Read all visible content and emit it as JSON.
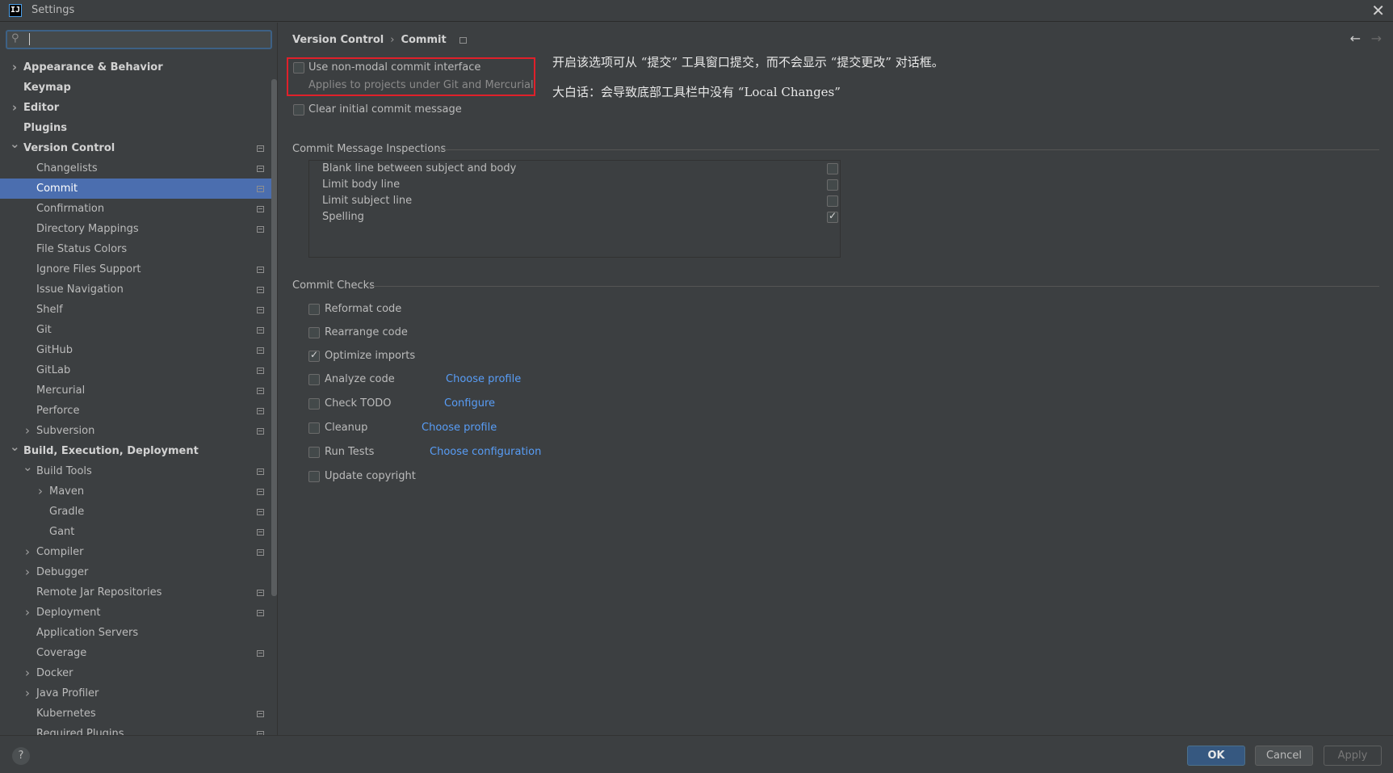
{
  "window": {
    "title": "Settings",
    "app_icon_text": "IJ"
  },
  "search": {
    "value": ""
  },
  "sidebar": {
    "items": [
      {
        "label": "Appearance & Behavior",
        "level": 0,
        "arrow": "right",
        "bold": true,
        "proj": false,
        "selected": false
      },
      {
        "label": "Keymap",
        "level": 0,
        "arrow": "",
        "bold": true,
        "proj": false,
        "selected": false
      },
      {
        "label": "Editor",
        "level": 0,
        "arrow": "right",
        "bold": true,
        "proj": false,
        "selected": false
      },
      {
        "label": "Plugins",
        "level": 0,
        "arrow": "",
        "bold": true,
        "proj": false,
        "selected": false
      },
      {
        "label": "Version Control",
        "level": 0,
        "arrow": "down",
        "bold": true,
        "proj": true,
        "selected": false
      },
      {
        "label": "Changelists",
        "level": 1,
        "arrow": "",
        "bold": false,
        "proj": true,
        "selected": false
      },
      {
        "label": "Commit",
        "level": 1,
        "arrow": "",
        "bold": false,
        "proj": true,
        "selected": true
      },
      {
        "label": "Confirmation",
        "level": 1,
        "arrow": "",
        "bold": false,
        "proj": true,
        "selected": false
      },
      {
        "label": "Directory Mappings",
        "level": 1,
        "arrow": "",
        "bold": false,
        "proj": true,
        "selected": false
      },
      {
        "label": "File Status Colors",
        "level": 1,
        "arrow": "",
        "bold": false,
        "proj": false,
        "selected": false
      },
      {
        "label": "Ignore Files Support",
        "level": 1,
        "arrow": "",
        "bold": false,
        "proj": true,
        "selected": false
      },
      {
        "label": "Issue Navigation",
        "level": 1,
        "arrow": "",
        "bold": false,
        "proj": true,
        "selected": false
      },
      {
        "label": "Shelf",
        "level": 1,
        "arrow": "",
        "bold": false,
        "proj": true,
        "selected": false
      },
      {
        "label": "Git",
        "level": 1,
        "arrow": "",
        "bold": false,
        "proj": true,
        "selected": false
      },
      {
        "label": "GitHub",
        "level": 1,
        "arrow": "",
        "bold": false,
        "proj": true,
        "selected": false
      },
      {
        "label": "GitLab",
        "level": 1,
        "arrow": "",
        "bold": false,
        "proj": true,
        "selected": false
      },
      {
        "label": "Mercurial",
        "level": 1,
        "arrow": "",
        "bold": false,
        "proj": true,
        "selected": false
      },
      {
        "label": "Perforce",
        "level": 1,
        "arrow": "",
        "bold": false,
        "proj": true,
        "selected": false
      },
      {
        "label": "Subversion",
        "level": 1,
        "arrow": "right",
        "bold": false,
        "proj": true,
        "selected": false
      },
      {
        "label": "Build, Execution, Deployment",
        "level": 0,
        "arrow": "down",
        "bold": true,
        "proj": false,
        "selected": false
      },
      {
        "label": "Build Tools",
        "level": 1,
        "arrow": "down",
        "bold": false,
        "proj": true,
        "selected": false
      },
      {
        "label": "Maven",
        "level": 2,
        "arrow": "right",
        "bold": false,
        "proj": true,
        "selected": false
      },
      {
        "label": "Gradle",
        "level": 2,
        "arrow": "",
        "bold": false,
        "proj": true,
        "selected": false
      },
      {
        "label": "Gant",
        "level": 2,
        "arrow": "",
        "bold": false,
        "proj": true,
        "selected": false
      },
      {
        "label": "Compiler",
        "level": 1,
        "arrow": "right",
        "bold": false,
        "proj": true,
        "selected": false
      },
      {
        "label": "Debugger",
        "level": 1,
        "arrow": "right",
        "bold": false,
        "proj": false,
        "selected": false
      },
      {
        "label": "Remote Jar Repositories",
        "level": 1,
        "arrow": "",
        "bold": false,
        "proj": true,
        "selected": false
      },
      {
        "label": "Deployment",
        "level": 1,
        "arrow": "right",
        "bold": false,
        "proj": true,
        "selected": false
      },
      {
        "label": "Application Servers",
        "level": 1,
        "arrow": "",
        "bold": false,
        "proj": false,
        "selected": false
      },
      {
        "label": "Coverage",
        "level": 1,
        "arrow": "",
        "bold": false,
        "proj": true,
        "selected": false
      },
      {
        "label": "Docker",
        "level": 1,
        "arrow": "right",
        "bold": false,
        "proj": false,
        "selected": false
      },
      {
        "label": "Java Profiler",
        "level": 1,
        "arrow": "right",
        "bold": false,
        "proj": false,
        "selected": false
      },
      {
        "label": "Kubernetes",
        "level": 1,
        "arrow": "",
        "bold": false,
        "proj": true,
        "selected": false
      },
      {
        "label": "Required Plugins",
        "level": 1,
        "arrow": "",
        "bold": false,
        "proj": true,
        "selected": false
      }
    ]
  },
  "breadcrumb": {
    "parent": "Version Control",
    "sep": "›",
    "current": "Commit"
  },
  "options": {
    "non_modal": {
      "label": "Use non-modal commit interface",
      "hint": "Applies to projects under Git and Mercurial",
      "checked": false
    },
    "clear_initial": {
      "label": "Clear initial commit message",
      "checked": false
    }
  },
  "annotations": {
    "line1": "开启该选项可从 “提交” 工具窗口提交，而不会显示 “提交更改” 对话框。",
    "line2": "大白话：会导致底部工具栏中没有 “Local Changes”"
  },
  "inspections": {
    "title": "Commit Message Inspections",
    "items": [
      {
        "label": "Blank line between subject and body",
        "checked": false
      },
      {
        "label": "Limit body line",
        "checked": false
      },
      {
        "label": "Limit subject line",
        "checked": false
      },
      {
        "label": "Spelling",
        "checked": true
      }
    ]
  },
  "checks": {
    "title": "Commit Checks",
    "items": [
      {
        "label": "Reformat code",
        "checked": false,
        "link": ""
      },
      {
        "label": "Rearrange code",
        "checked": false,
        "link": ""
      },
      {
        "label": "Optimize imports",
        "checked": true,
        "link": ""
      },
      {
        "label": "Analyze code",
        "checked": false,
        "link": "Choose profile"
      },
      {
        "label": "Check TODO",
        "checked": false,
        "link": "Configure"
      },
      {
        "label": "Cleanup",
        "checked": false,
        "link": "Choose profile"
      },
      {
        "label": "Run Tests",
        "checked": false,
        "link": "Choose configuration"
      },
      {
        "label": "Update copyright",
        "checked": false,
        "link": ""
      }
    ]
  },
  "buttons": {
    "ok": "OK",
    "cancel": "Cancel",
    "apply": "Apply",
    "help": "?"
  },
  "colors": {
    "accent": "#4b6eaf",
    "link": "#589df6",
    "highlight_box": "#e0202a",
    "background": "#3c3f41"
  }
}
